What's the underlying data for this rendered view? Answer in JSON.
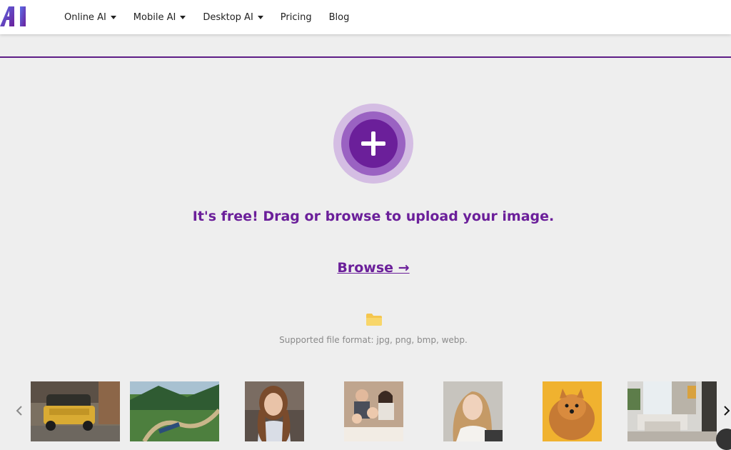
{
  "header": {
    "nav": [
      {
        "label": "Online AI",
        "dropdown": true
      },
      {
        "label": "Mobile AI",
        "dropdown": true
      },
      {
        "label": "Desktop AI",
        "dropdown": true
      },
      {
        "label": "Pricing",
        "dropdown": false
      },
      {
        "label": "Blog",
        "dropdown": false
      }
    ]
  },
  "upload": {
    "icon": "plus-icon",
    "headline": "It's free! Drag or browse to upload your image.",
    "browse_label": "Browse →",
    "folder_icon": "folder-icon",
    "formats_text": "Supported file format: jpg, png, bmp, webp."
  },
  "samples": [
    {
      "name": "sample-yellow-car"
    },
    {
      "name": "sample-mountain-train"
    },
    {
      "name": "sample-girl-portrait"
    },
    {
      "name": "sample-family-photo"
    },
    {
      "name": "sample-woman-smiling"
    },
    {
      "name": "sample-pomeranian-dog"
    },
    {
      "name": "sample-living-room"
    }
  ],
  "colors": {
    "accent": "#6b1f9a",
    "accent_ring_outer": "#d4bde3",
    "accent_ring_mid": "#9a62c2",
    "background": "#eeeeee"
  }
}
